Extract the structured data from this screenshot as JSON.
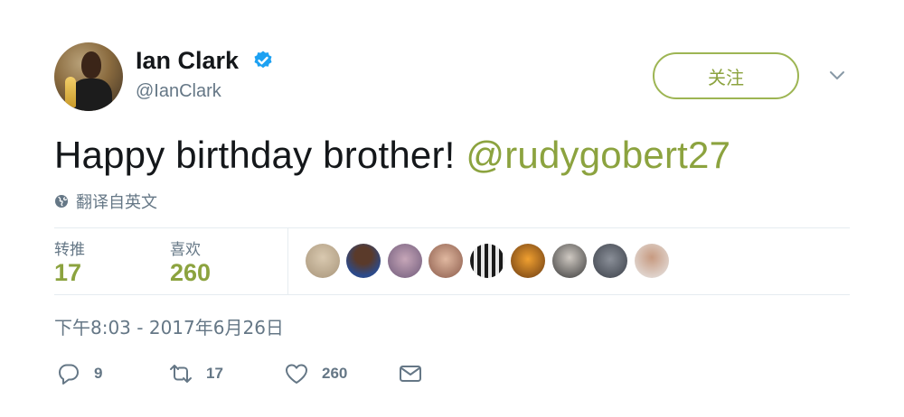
{
  "header": {
    "name": "Ian Clark",
    "handle": "@IanClark",
    "follow_label": "关注"
  },
  "tweet": {
    "text": "Happy birthday brother! ",
    "mention": "@rudygobert27",
    "translate_label": "翻译自英文"
  },
  "stats": {
    "retweets_label": "转推",
    "retweets_value": "17",
    "likes_label": "喜欢",
    "likes_value": "260"
  },
  "timestamp": "下午8:03 - 2017年6月26日",
  "actions": {
    "reply_count": "9",
    "retweet_count": "17",
    "like_count": "260"
  },
  "colors": {
    "accent": "#8ca33f",
    "follow_border": "#9db553",
    "muted": "#657786",
    "text": "#14171a",
    "divider": "#e6ecf0",
    "verified": "#1da1f2"
  },
  "icons": {
    "verified": "verified-badge-icon",
    "chevron": "chevron-down-icon",
    "globe": "globe-icon",
    "reply": "reply-icon",
    "retweet": "retweet-icon",
    "like": "heart-icon",
    "message": "envelope-icon"
  }
}
